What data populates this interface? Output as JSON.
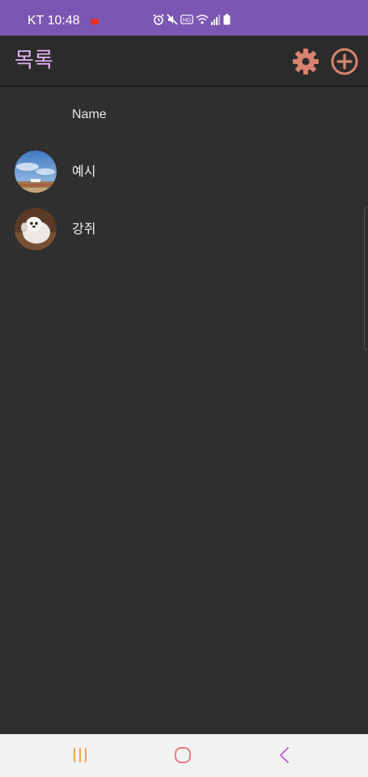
{
  "status_bar": {
    "carrier_time": "KT 10:48",
    "icons": [
      "notification-icon",
      "alarm-icon",
      "mute-icon",
      "hd-icon",
      "wifi-icon",
      "signal-icon",
      "battery-icon"
    ],
    "background_color": "#7a57b3"
  },
  "app_bar": {
    "title": "목록",
    "title_color": "#e0b3ef",
    "action_icons": [
      "gear-icon",
      "add-circle-icon"
    ],
    "action_color": "#d98470"
  },
  "list": {
    "header_label": "Name",
    "items": [
      {
        "label": "예시",
        "avatar": "landscape-photo"
      },
      {
        "label": "강쥐",
        "avatar": "dog-photo"
      }
    ]
  },
  "nav_bar": {
    "icons": [
      "recents-icon",
      "home-icon",
      "back-icon"
    ]
  }
}
